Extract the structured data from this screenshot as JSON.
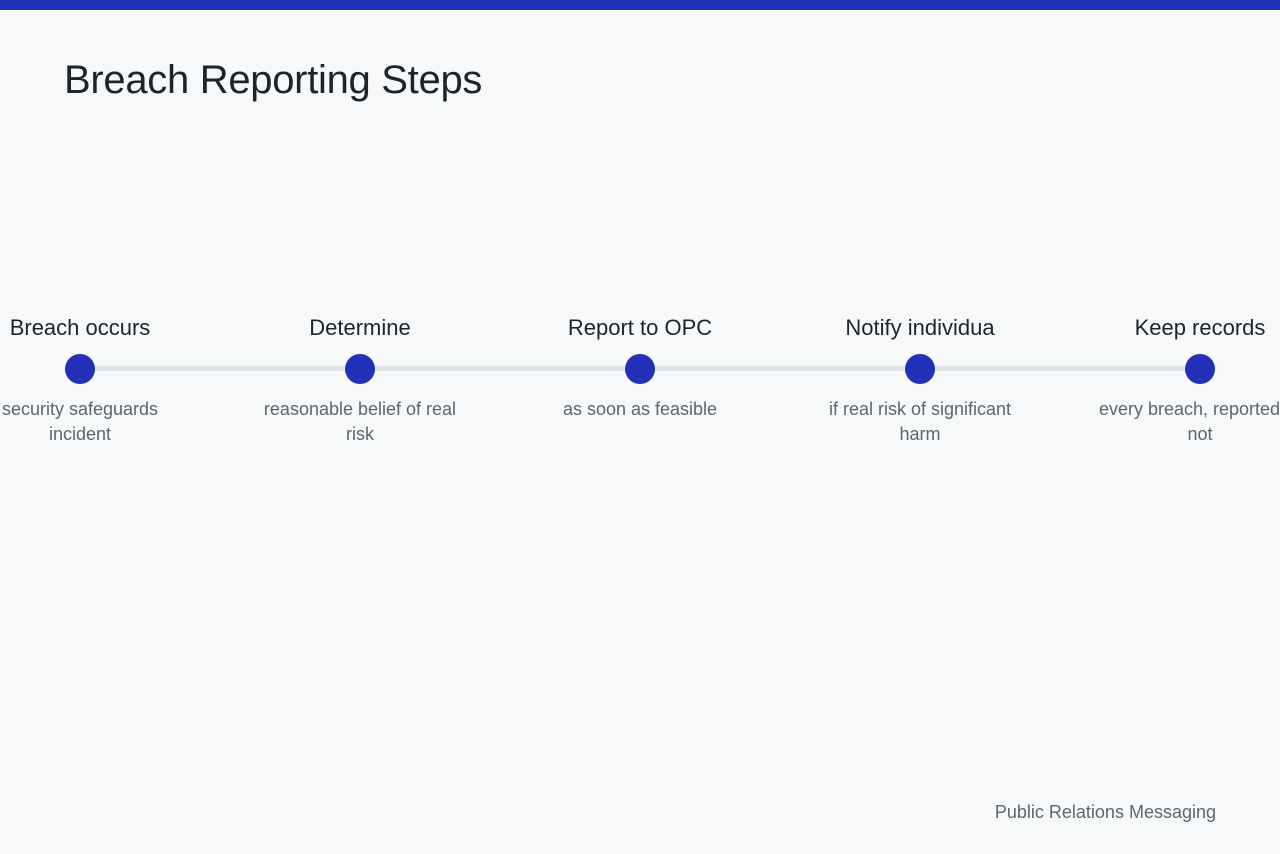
{
  "theme": {
    "accent": "#2230b8",
    "track": "#dfe5e6",
    "background": "#f6f8fa",
    "text": "#1c2628",
    "muted_text": "#5b6769"
  },
  "title": "Breach Reporting Steps",
  "steps": [
    {
      "label": "Breach occurs",
      "description": "security safeguards incident"
    },
    {
      "label": "Determine",
      "description": "reasonable belief of real risk"
    },
    {
      "label": "Report to OPC",
      "description": "as soon as feasible"
    },
    {
      "label": "Notify individua",
      "description": "if real risk of significant harm"
    },
    {
      "label": "Keep records",
      "description": "every breach, reported or not"
    }
  ],
  "footer": "Public Relations Messaging"
}
